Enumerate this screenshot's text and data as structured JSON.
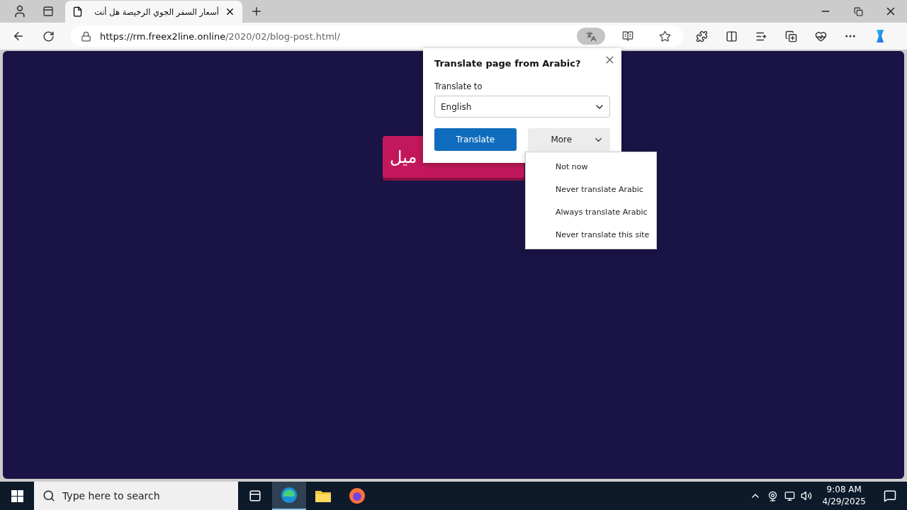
{
  "tabs": [
    {
      "title": "أسعار السفر الجوي الرخيصة هل أنت",
      "selected": true
    }
  ],
  "address_bar": {
    "url_host": "https://rm.freex2line.online",
    "url_path": "/2020/02/blog-post.html/"
  },
  "page": {
    "button_label": "ميل"
  },
  "translate_popup": {
    "title": "Translate page from Arabic?",
    "field_label": "Translate to",
    "language": "English",
    "primary_button": "Translate",
    "more_button": "More",
    "more_expanded": true
  },
  "more_menu": [
    "Not now",
    "Never translate Arabic",
    "Always translate Arabic",
    "Never translate this site"
  ],
  "taskbar": {
    "search_placeholder": "Type here to search",
    "time": "9:08 AM",
    "date": "4/29/2025"
  }
}
